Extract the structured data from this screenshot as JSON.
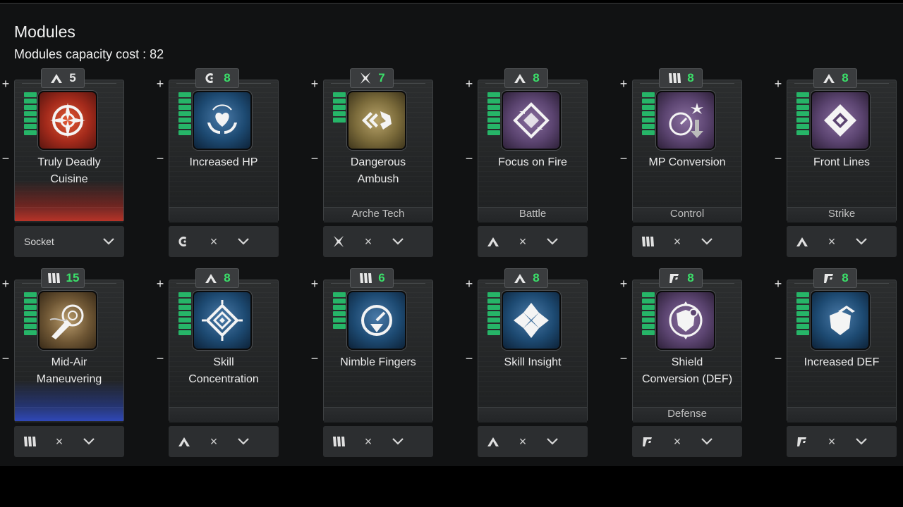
{
  "header": {
    "title": "Modules",
    "capacity": "Modules capacity cost : 82"
  },
  "cards": [
    {
      "name": "Truly Deadly\nCuisine",
      "cost": "5",
      "cost_highlight": false,
      "badge_icon": "attack-chevron-icon",
      "category": "",
      "socket": "Socket",
      "tile": "red",
      "glow": "red",
      "bars": 7,
      "tile_icon": "gear-sun-icon"
    },
    {
      "name": "Increased HP",
      "cost": "8",
      "cost_highlight": true,
      "badge_icon": "crescent-c-icon",
      "category": "",
      "socket": "",
      "tile": "blue",
      "glow": "",
      "bars": 7,
      "tile_icon": "heart-hands-icon"
    },
    {
      "name": "Dangerous\nAmbush",
      "cost": "7",
      "cost_highlight": true,
      "badge_icon": "cross-star-icon",
      "category": "Arche Tech",
      "socket": "",
      "tile": "gold",
      "glow": "",
      "bars": 5,
      "tile_icon": "ambush-icon"
    },
    {
      "name": "Focus on Fire",
      "cost": "8",
      "cost_highlight": true,
      "badge_icon": "attack-chevron-icon",
      "category": "Battle",
      "socket": "",
      "tile": "purple",
      "glow": "",
      "bars": 7,
      "tile_icon": "diamond-arrows-icon"
    },
    {
      "name": "MP Conversion",
      "cost": "8",
      "cost_highlight": true,
      "badge_icon": "triple-bar-icon",
      "category": "Control",
      "socket": "",
      "tile": "purple",
      "glow": "",
      "bars": 7,
      "tile_icon": "gauge-arrow-icon"
    },
    {
      "name": "Front Lines",
      "cost": "8",
      "cost_highlight": true,
      "badge_icon": "attack-chevron-icon",
      "category": "Strike",
      "socket": "",
      "tile": "purple",
      "glow": "",
      "bars": 7,
      "tile_icon": "diamond-burst-icon"
    },
    {
      "name": "Mid-Air\nManeuvering",
      "cost": "15",
      "cost_highlight": true,
      "badge_icon": "triple-bar-icon",
      "category": "",
      "socket": "",
      "tile": "brown",
      "glow": "blue",
      "bars": 7,
      "tile_icon": "claw-target-icon"
    },
    {
      "name": "Skill\nConcentration",
      "cost": "8",
      "cost_highlight": true,
      "badge_icon": "attack-chevron-icon",
      "category": "",
      "socket": "",
      "tile": "blue",
      "glow": "",
      "bars": 7,
      "tile_icon": "diamond-rays-icon"
    },
    {
      "name": "Nimble Fingers",
      "cost": "6",
      "cost_highlight": true,
      "badge_icon": "triple-bar-icon",
      "category": "",
      "socket": "",
      "tile": "blue",
      "glow": "",
      "bars": 6,
      "tile_icon": "clock-arrow-icon"
    },
    {
      "name": "Skill Insight",
      "cost": "8",
      "cost_highlight": true,
      "badge_icon": "attack-chevron-icon",
      "category": "",
      "socket": "",
      "tile": "blue",
      "glow": "",
      "bars": 7,
      "tile_icon": "diamond-split-icon"
    },
    {
      "name": "Shield\nConversion (DEF)",
      "cost": "8",
      "cost_highlight": true,
      "badge_icon": "slash-bracket-icon",
      "category": "Defense",
      "socket": "",
      "tile": "purple",
      "glow": "",
      "bars": 7,
      "tile_icon": "shield-cycle-icon"
    },
    {
      "name": "Increased DEF",
      "cost": "8",
      "cost_highlight": true,
      "badge_icon": "slash-bracket-icon",
      "category": "",
      "socket": "",
      "tile": "blue",
      "glow": "",
      "bars": 7,
      "tile_icon": "shield-up-icon"
    }
  ],
  "controls": {
    "plus": "+",
    "minus": "−",
    "remove": "×"
  },
  "colors": {
    "accent_green": "#3be06a",
    "bar_green": "#26b568"
  }
}
